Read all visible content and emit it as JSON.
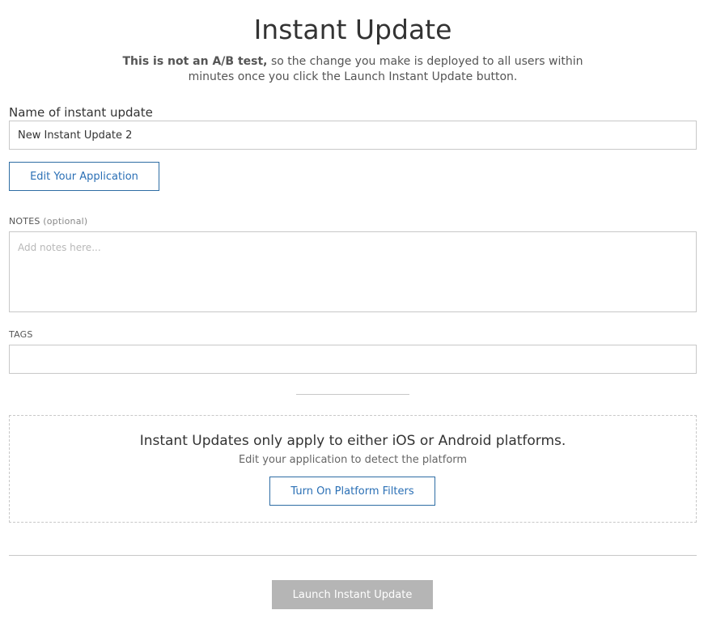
{
  "page": {
    "title": "Instant Update",
    "subtitle_bold": "This is not an A/B test,",
    "subtitle_rest": " so the change you make is deployed to all users within minutes once you click the Launch Instant Update button."
  },
  "form": {
    "name_label": "Name of instant update",
    "name_value": "New Instant Update 2",
    "edit_button": "Edit Your Application",
    "notes_label": "NOTES",
    "notes_optional": "(optional)",
    "notes_placeholder": "Add notes here...",
    "tags_label": "TAGS",
    "tags_value": ""
  },
  "platform": {
    "heading": "Instant Updates only apply to either iOS or Android platforms.",
    "subtext": "Edit your application to detect the platform",
    "filter_button": "Turn On Platform Filters"
  },
  "footer": {
    "launch_button": "Launch Instant Update"
  },
  "colors": {
    "accent": "#2a6fb5",
    "disabled_button": "#b5b5b5",
    "border": "#c8c8c8"
  }
}
